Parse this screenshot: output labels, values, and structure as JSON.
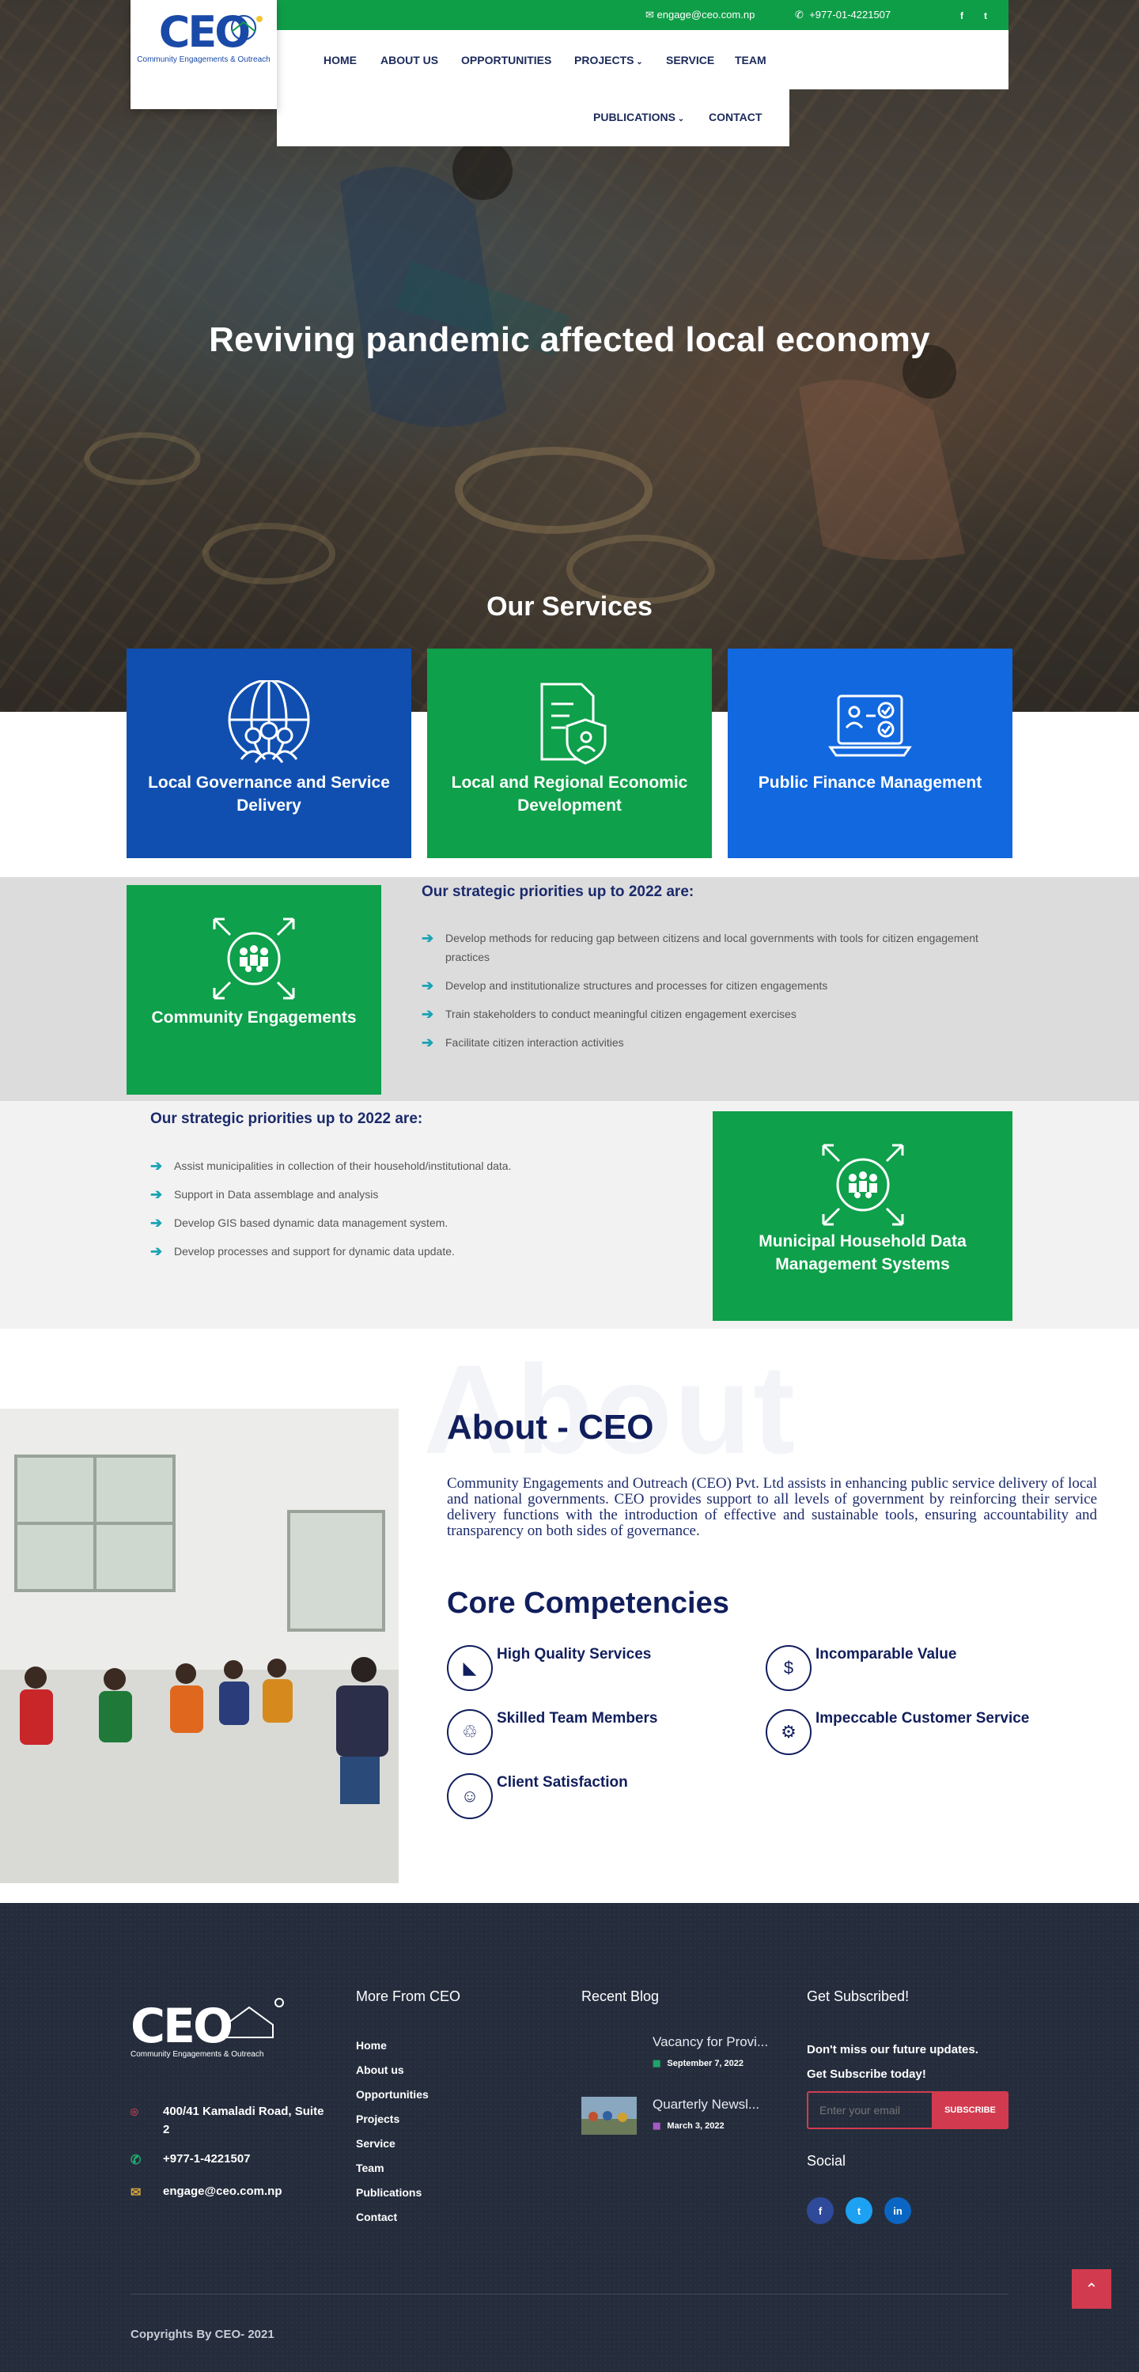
{
  "header": {
    "logo_text": "CEO",
    "logo_subtitle": "Community Engagements & Outreach",
    "email": "engage@ceo.com.np",
    "phone": "+977-01-4221507",
    "social": [
      "f",
      "t"
    ],
    "nav_row1": [
      "HOME",
      "ABOUT US",
      "OPPORTUNITIES",
      "PROJECTS",
      "SERVICE",
      "TEAM"
    ],
    "nav_row2": [
      "PUBLICATIONS",
      "CONTACT"
    ]
  },
  "hero": {
    "title": "Reviving pandemic affected local economy",
    "services_heading": "Our Services"
  },
  "services": [
    {
      "label": "Local Governance and Service Delivery",
      "icon": "globe-people-icon",
      "color": "#104fb0"
    },
    {
      "label": "Local and Regional Economic Development",
      "icon": "document-shield-icon",
      "color": "#0ea04a"
    },
    {
      "label": "Public Finance Management",
      "icon": "laptop-checklist-icon",
      "color": "#1168df"
    }
  ],
  "community": {
    "box_label": "Community Engagements",
    "priorities_title": "Our strategic priorities up to 2022 are:",
    "priorities": [
      "Develop methods for reducing gap between citizens and local governments with tools for citizen engagement practices",
      "Develop and institutionalize structures and processes for citizen engagements",
      "Train stakeholders to conduct meaningful citizen engagement exercises",
      "Facilitate citizen interaction activities"
    ]
  },
  "household": {
    "box_label": "Municipal Household Data Management Systems",
    "priorities_title": "Our strategic priorities up to 2022 are:",
    "priorities": [
      "Assist municipalities in collection of their household/institutional data.",
      "Support in Data assemblage and analysis",
      "Develop GIS based dynamic data management system.",
      "Develop processes and support for dynamic data update."
    ]
  },
  "about": {
    "watermark": "About",
    "title": "About - CEO",
    "text": "Community Engagements and Outreach (CEO) Pvt. Ltd assists in enhancing public service delivery of local and national governments. CEO provides support to all levels of government by reinforcing their service delivery functions with the introduction of effective and sustainable tools, ensuring accountability and transparency on both sides of governance.",
    "competencies_title": "Core Competencies",
    "competencies": [
      {
        "label": "High Quality Services",
        "icon": "quality-icon"
      },
      {
        "label": "Incomparable Value",
        "icon": "value-icon"
      },
      {
        "label": "Skilled Team Members",
        "icon": "team-icon"
      },
      {
        "label": "Impeccable Customer Service",
        "icon": "gear-icon"
      },
      {
        "label": "Client Satisfaction",
        "icon": "smile-icon"
      }
    ]
  },
  "footer": {
    "logo_text": "CEO",
    "logo_subtitle": "Community Engagements & Outreach",
    "address": "400/41 Kamaladi Road, Suite 2",
    "phone": "+977-1-4221507",
    "email": "engage@ceo.com.np",
    "more_title": "More From CEO",
    "links": [
      "Home",
      "About us",
      "Opportunities",
      "Projects",
      "Service",
      "Team",
      "Publications",
      "Contact"
    ],
    "blog_title": "Recent Blog",
    "blog": [
      {
        "title": "Vacancy for Provi...",
        "date": "September 7, 2022"
      },
      {
        "title": "Quarterly Newsl...",
        "date": "March 3, 2022"
      }
    ],
    "subscribe_title": "Get Subscribed!",
    "subscribe_text_1": "Don't miss our future updates.",
    "subscribe_text_2": "Get Subscribe today!",
    "subscribe_placeholder": "Enter your email",
    "subscribe_button": "SUBSCRIBE",
    "social_title": "Social",
    "social": [
      "f",
      "t",
      "in"
    ],
    "copyright": "Copyrights By CEO- 2021"
  },
  "colors": {
    "brand_green": "#0ea04a",
    "brand_blue": "#104fb0",
    "navy": "#111e5c",
    "accent_red": "#d23b4f",
    "footer_bg": "#252d3d"
  }
}
